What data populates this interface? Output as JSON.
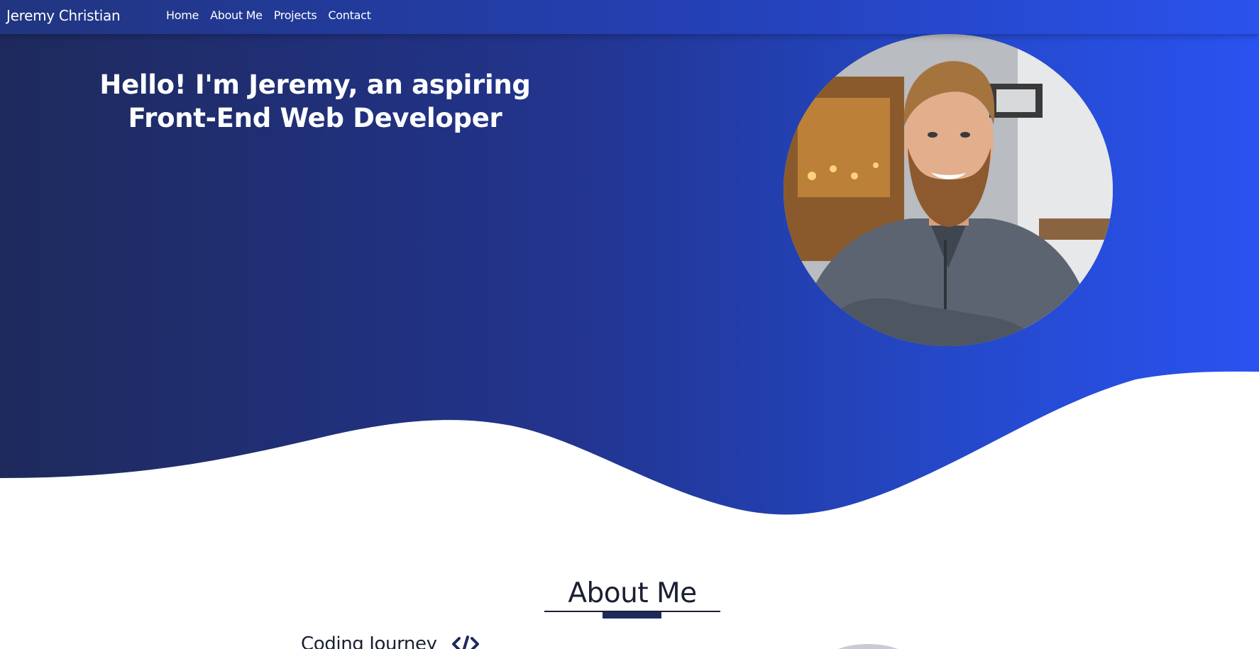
{
  "navbar": {
    "brand": "Jeremy Christian",
    "links": [
      "Home",
      "About Me",
      "Projects",
      "Contact"
    ]
  },
  "hero": {
    "title": "Hello! I'm Jeremy, an aspiring Front-End Web Developer"
  },
  "about": {
    "title": "About Me",
    "subsection": "Coding Journey"
  },
  "colors": {
    "hero_dark": "#1e2a5c",
    "hero_light": "#2a52f0",
    "accent": "#1e2a5c",
    "text_dark": "#1b1f33"
  },
  "icons": {
    "code": "code-icon"
  }
}
